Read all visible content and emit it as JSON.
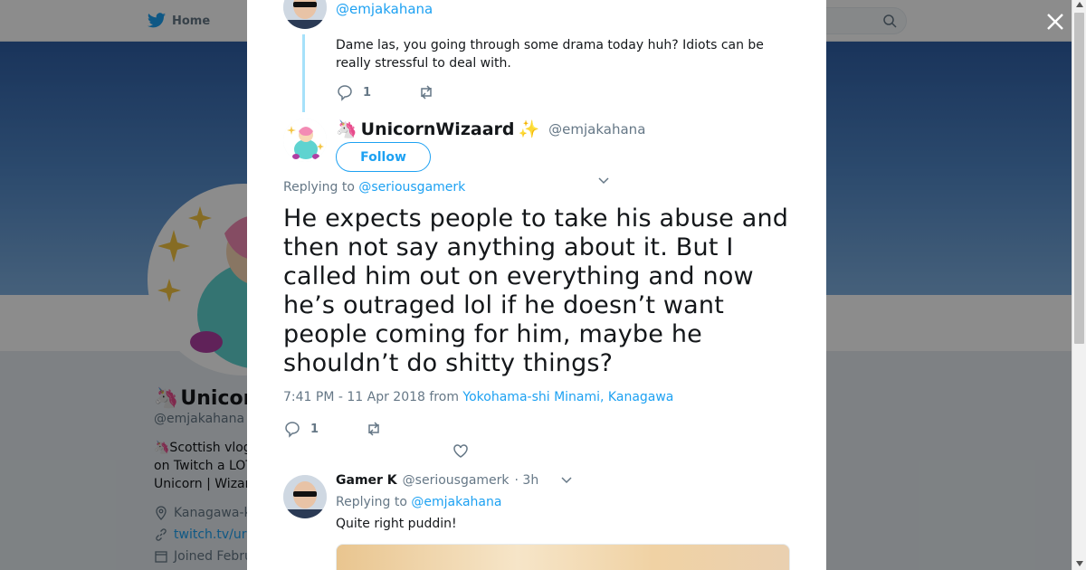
{
  "background": {
    "nav": {
      "home_label": "Home"
    },
    "profile": {
      "name_prefix": "🦄",
      "name": "Unicorn",
      "handle": "@emjakahana",
      "bio_lines": [
        "🦄Scottish vlog",
        "on Twitch a LOT",
        "Unicorn | Wizar"
      ],
      "location": "Kanagawa-k",
      "link": "twitch.tv/ur",
      "joined": "Joined Febru"
    }
  },
  "modal": {
    "parent_tweet": {
      "handle": "@emjakahana",
      "text": "Dame las, you going through some drama today huh? Idiots can be really stressful to deal with.",
      "reply_count": "1"
    },
    "main_tweet": {
      "display_emoji_left": "🦄",
      "display_name": "UnicornWizaard",
      "display_emoji_right": "✨",
      "handle": "@emjakahana",
      "follow_label": "Follow",
      "replying_prefix": "Replying to",
      "replying_to": "@seriousgamerk",
      "text": "He expects people to take his abuse and then not say anything about it. But I called him out on everything and now he’s outraged lol if he doesn’t want people coming for him, maybe he shouldn’t do shitty things?",
      "timestamp": "7:41 PM - 11 Apr 2018 from",
      "location": "Yokohama-shi Minami, Kanagawa",
      "reply_count": "1"
    },
    "reply_tweet": {
      "name": "Gamer K",
      "handle": "@seriousgamerk",
      "time": "· 3h",
      "replying_prefix": "Replying to",
      "replying_to": "@emjakahana",
      "text": "Quite right puddin!"
    }
  },
  "colors": {
    "accent": "#1da1f2",
    "secondary_text": "#657786",
    "thread_line": "#a6e1fa"
  }
}
